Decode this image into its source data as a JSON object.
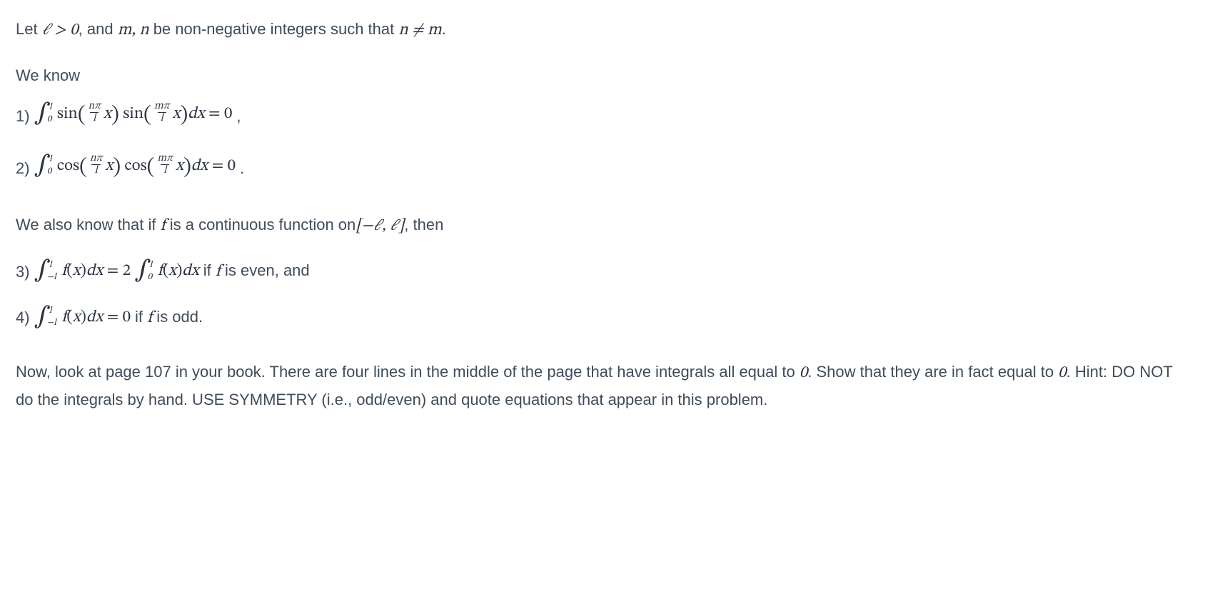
{
  "p1": {
    "t1": "Let ",
    "m1": "ℓ > 0",
    "t2": ", and ",
    "m2": "m, n",
    "t3": " be non-negative integers such that ",
    "m3": "n ≠ m",
    "t4": "."
  },
  "p2": {
    "t1": "We know"
  },
  "items12": {
    "i1": {
      "prefix": "1)",
      "func": "sin",
      "eq": " = 0",
      "tail": ","
    },
    "i2": {
      "prefix": "2)",
      "func": "cos",
      "eq": " = 0",
      "tail": "."
    }
  },
  "int_lims": {
    "lo": "0",
    "hi": "l",
    "lo_neg": "−l"
  },
  "arg": {
    "lpar": "(",
    "rpar": ")",
    "frac_n_num": "nπ",
    "frac_m_num": "mπ",
    "frac_den": "l",
    "x": "x",
    "dx": "dx"
  },
  "p3": {
    "t1": "We also know that if ",
    "m1": "f",
    "t2": " is a continuous function on",
    "m2": "[−ℓ, ℓ]",
    "t3": ", then"
  },
  "items34": {
    "i3": {
      "prefix": "3)",
      "mid": " = 2 ",
      "tail_t1": " if ",
      "tail_m": "f",
      "tail_t2": " is even, and"
    },
    "i4": {
      "prefix": "4)",
      "eq": " = 0",
      "tail_t1": " if ",
      "tail_m": "f",
      "tail_t2": " is odd."
    }
  },
  "fx": {
    "f": "f",
    "lpar": "(",
    "x": "x",
    "rpar": ")",
    "dx": "dx"
  },
  "p4": {
    "t1": "Now, look at page 107 in your book. There are four lines in the middle of the page that have integrals all equal to ",
    "m1": "0",
    "t2": ". Show that they are in fact equal to ",
    "m2": "0",
    "t3": ". Hint: DO NOT do the integrals by hand. USE SYMMETRY (i.e., odd/even) and quote equations that appear in this problem."
  }
}
